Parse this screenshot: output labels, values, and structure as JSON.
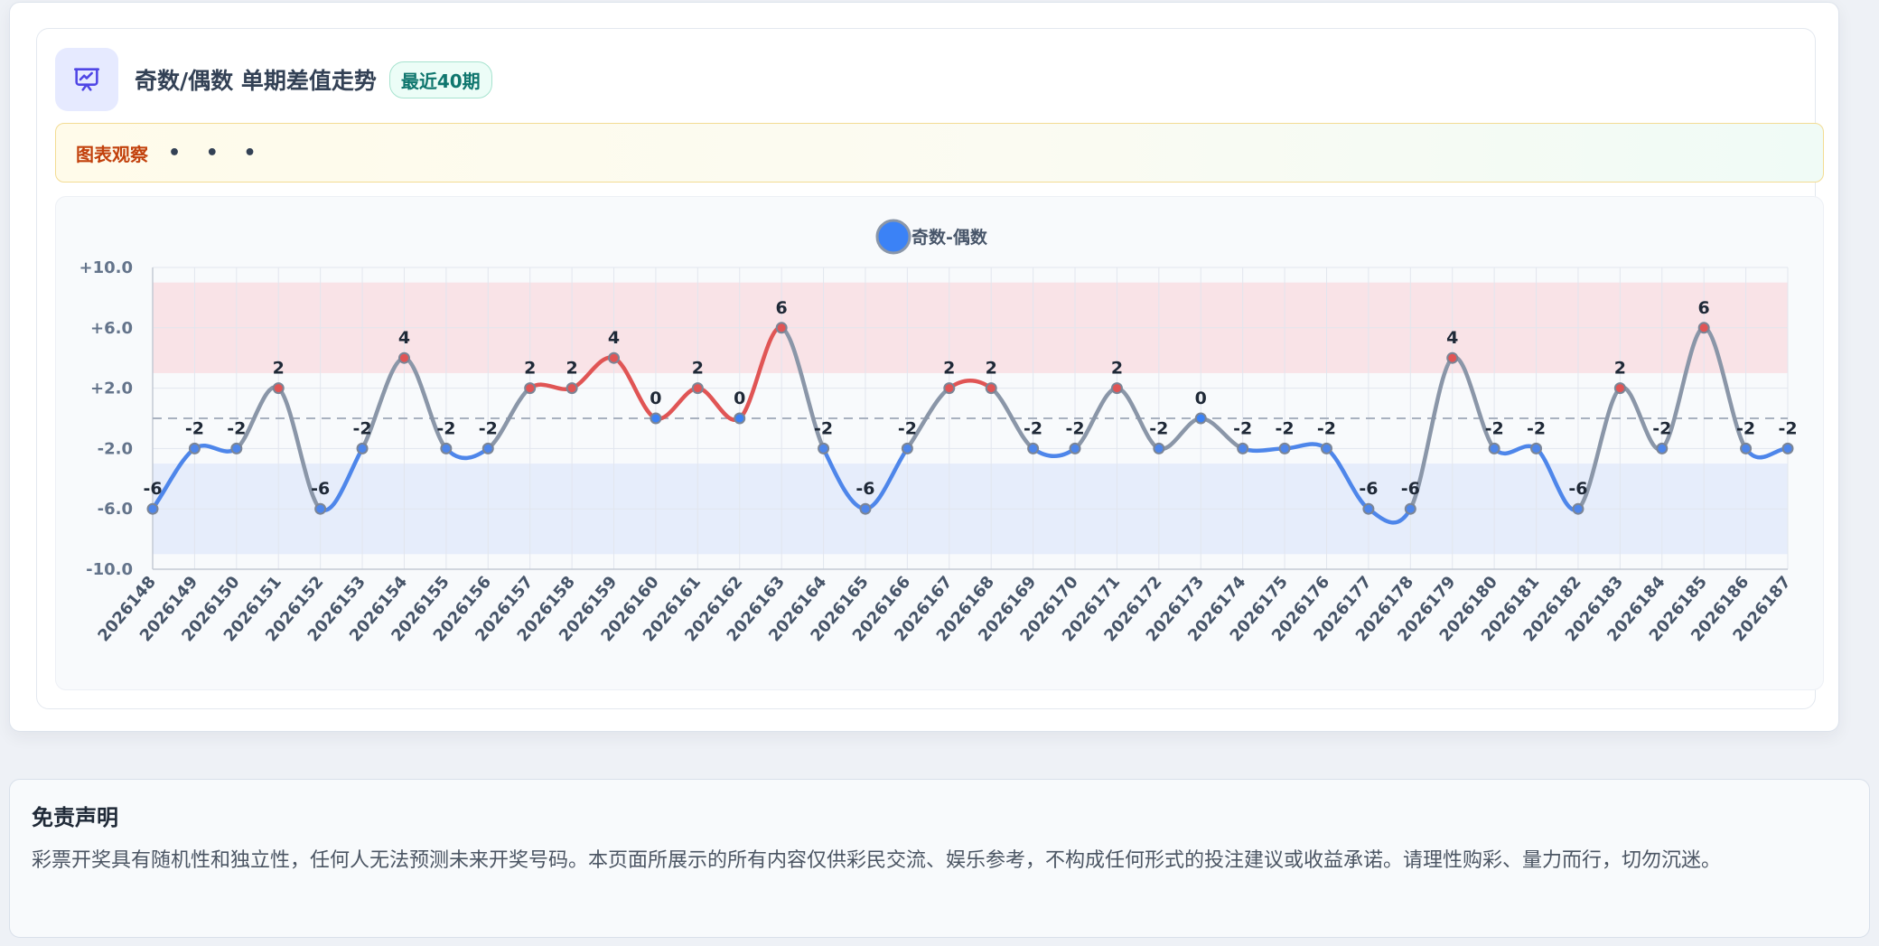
{
  "header": {
    "title": "奇数/偶数 单期差值走势",
    "badge": "最近40期",
    "icon": "presentation-chart-icon"
  },
  "observation": {
    "label": "图表观察",
    "dots": "• • •"
  },
  "disclaimer": {
    "title": "免责声明",
    "text": "彩票开奖具有随机性和独立性，任何人无法预测未来开奖号码。本页面所展示的所有内容仅供彩民交流、娱乐参考，不构成任何形式的投注建议或收益承诺。请理性购彩、量力而行，切勿沉迷。"
  },
  "colors": {
    "positive": "#e05555",
    "negative": "#4e86ea",
    "neutral": "#8a96a8",
    "legend": "#3b82f6",
    "positive_band": "#f9e3e7",
    "negative_band": "#e6edfb"
  },
  "chart_data": {
    "type": "line",
    "series": [
      {
        "name": "奇数-偶数",
        "values": [
          -6,
          -2,
          -2,
          2,
          -6,
          -2,
          4,
          -2,
          -2,
          2,
          2,
          4,
          0,
          2,
          0,
          6,
          -2,
          -6,
          -2,
          2,
          2,
          -2,
          -2,
          2,
          -2,
          0,
          -2,
          -2,
          -2,
          -6,
          -6,
          4,
          -2,
          -2,
          -6,
          2,
          -2,
          6,
          -2,
          -2
        ]
      }
    ],
    "categories": [
      "2026148",
      "2026149",
      "2026150",
      "2026151",
      "2026152",
      "2026153",
      "2026154",
      "2026155",
      "2026156",
      "2026157",
      "2026158",
      "2026159",
      "2026160",
      "2026161",
      "2026162",
      "2026163",
      "2026164",
      "2026165",
      "2026166",
      "2026167",
      "2026168",
      "2026169",
      "2026170",
      "2026171",
      "2026172",
      "2026173",
      "2026174",
      "2026175",
      "2026176",
      "2026177",
      "2026178",
      "2026179",
      "2026180",
      "2026181",
      "2026182",
      "2026183",
      "2026184",
      "2026185",
      "2026186",
      "2026187"
    ],
    "y_ticks": [
      "+10.0",
      "+6.0",
      "+2.0",
      "-2.0",
      "-6.0",
      "-10.0"
    ],
    "ylim": [
      -10,
      10
    ],
    "bands": [
      {
        "from": 3,
        "to": 9,
        "tone": "positive"
      },
      {
        "from": -9,
        "to": -3,
        "tone": "negative"
      }
    ],
    "reference_line": 0,
    "legend_position": "top-center",
    "grid": true,
    "data_labels": true,
    "smooth": true
  }
}
